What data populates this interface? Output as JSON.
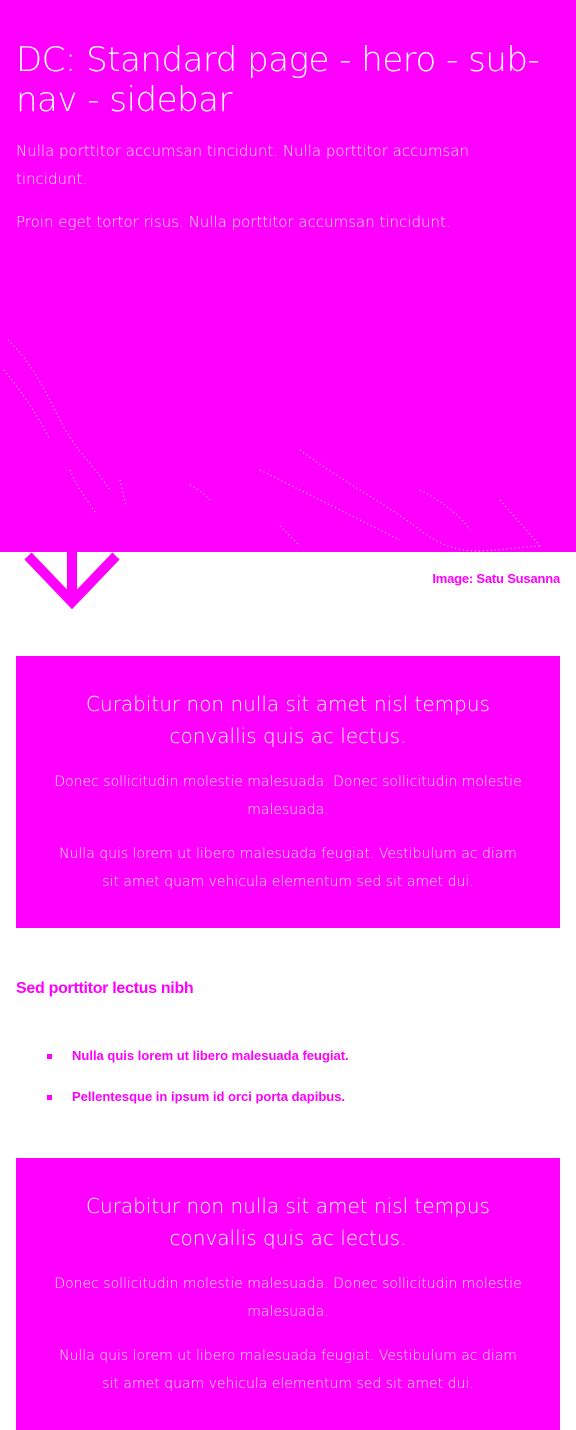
{
  "hero": {
    "title": "DC: Standard page - hero - sub-nav - sidebar",
    "paragraphs": [
      "Nulla porttitor accumsan tincidunt. Nulla porttitor accumsan tincidunt.",
      "Proin eget tortor risus. Nulla porttitor accumsan tincidunt."
    ],
    "image_credit": "Image: Satu Susanna"
  },
  "callouts": [
    {
      "heading": "Curabitur non nulla sit amet nisl tempus convallis quis ac lectus.",
      "paragraphs": [
        "Donec sollicitudin molestie malesuada. Donec sollicitudin molestie malesuada.",
        "Nulla quis lorem ut libero malesuada feugiat. Vestibulum ac diam sit amet quam vehicula elementum sed sit amet dui."
      ]
    },
    {
      "heading": "Curabitur non nulla sit amet nisl tempus convallis quis ac lectus.",
      "paragraphs": [
        "Donec sollicitudin molestie malesuada. Donec sollicitudin molestie malesuada.",
        "Nulla quis lorem ut libero malesuada feugiat. Vestibulum ac diam sit amet quam vehicula elementum sed sit amet dui."
      ]
    }
  ],
  "section": {
    "heading": "Sed porttitor lectus nibh",
    "bullets": [
      "Nulla quis lorem ut libero malesuada feugiat.",
      "Pellentesque in ipsum id orci porta dapibus."
    ]
  },
  "icons": {
    "scroll": "arrow-down-icon"
  },
  "colors": {
    "brand": "#ff00ff",
    "text_on_brand": "#ffffff",
    "background": "#ffffff"
  }
}
